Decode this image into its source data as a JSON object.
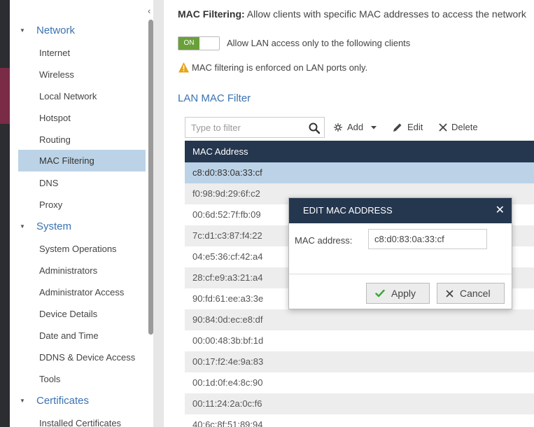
{
  "sidebar": {
    "collapse_glyph": "‹",
    "network": {
      "label": "Network",
      "items": [
        "Internet",
        "Wireless",
        "Local Network",
        "Hotspot",
        "Routing",
        "MAC Filtering",
        "DNS",
        "Proxy"
      ]
    },
    "system": {
      "label": "System",
      "items": [
        "System Operations",
        "Administrators",
        "Administrator Access",
        "Device Details",
        "Date and Time",
        "DDNS & Device Access",
        "Tools"
      ]
    },
    "certificates": {
      "label": "Certificates",
      "items": [
        "Installed Certificates"
      ]
    },
    "selected_item": "MAC Filtering"
  },
  "main": {
    "header_title": "MAC Filtering:",
    "header_desc": " Allow clients with specific MAC addresses to access the network",
    "toggle_on_label": "ON",
    "toggle_label": "Allow LAN access only to the following clients",
    "warning_text": "MAC filtering is enforced on LAN ports only.",
    "section_title": "LAN MAC Filter",
    "filter_placeholder": "Type to filter",
    "toolbar": {
      "add": "Add",
      "edit": "Edit",
      "delete": "Delete"
    },
    "table": {
      "column": "MAC Address",
      "rows": [
        "c8:d0:83:0a:33:cf",
        "f0:98:9d:29:6f:c2",
        "00:6d:52:7f:fb:09",
        "7c:d1:c3:87:f4:22",
        "04:e5:36:cf:42:a4",
        "28:cf:e9:a3:21:a4",
        "90:fd:61:ee:a3:3e",
        "90:84:0d:ec:e8:df",
        "00:00:48:3b:bf:1d",
        "00:17:f2:4e:9a:83",
        "00:1d:0f:e4:8c:90",
        "00:11:24:2a:0c:f6",
        "40:6c:8f:51:89:94"
      ],
      "selected_row": 0
    }
  },
  "modal": {
    "title": "EDIT MAC ADDRESS",
    "close_glyph": "✕",
    "field_label": "MAC address:",
    "field_value": "c8:d0:83:0a:33:cf",
    "apply_label": "Apply",
    "cancel_label": "Cancel"
  },
  "colors": {
    "sidebar_link": "#3a72b0",
    "selection": "#bcd3e7",
    "header_bar": "#25374f",
    "toggle_on": "#6aa03a",
    "warning": "#e8a317",
    "apply_check": "#3ca53c"
  },
  "icons": [
    "collapse-icon",
    "triangle-down-icon",
    "warning-icon",
    "search-icon",
    "add-icon",
    "dropdown-caret-icon",
    "edit-icon",
    "delete-icon",
    "close-icon",
    "check-icon",
    "cancel-icon"
  ]
}
